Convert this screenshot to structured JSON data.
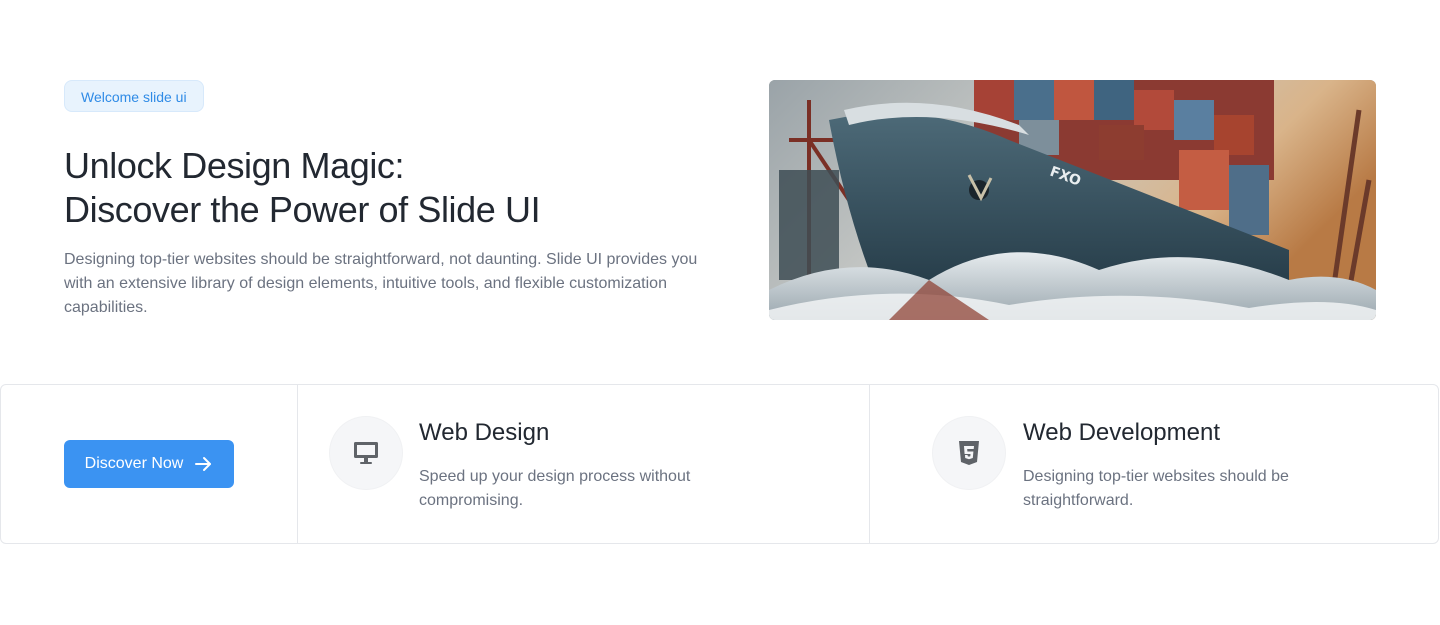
{
  "hero": {
    "badge": "Welcome slide ui",
    "title_line1": "Unlock Design Magic:",
    "title_line2": "Discover the Power of Slide UI",
    "description": "Designing top-tier websites should be straightforward, not daunting. Slide UI provides you with an extensive library of design elements, intuitive tools, and flexible customization capabilities.",
    "image": {
      "subject": "container cargo ship bow crashing through waves near harbor cranes",
      "hull_lettering": "FXO"
    }
  },
  "features": {
    "cta": {
      "label": "Discover Now",
      "icon": "arrow-right-icon"
    },
    "items": [
      {
        "icon": "monitor-icon",
        "title": "Web Design",
        "description": "Speed up your design process without compromising."
      },
      {
        "icon": "html5-icon",
        "title": "Web Development",
        "description": "Designing top-tier websites should be straightforward."
      }
    ]
  },
  "colors": {
    "accent": "#3b93f2",
    "badge_bg": "#e8f3fd",
    "badge_text": "#2f8be6",
    "heading": "#222831",
    "body_text": "#6b7280",
    "border": "#e5e7eb"
  }
}
